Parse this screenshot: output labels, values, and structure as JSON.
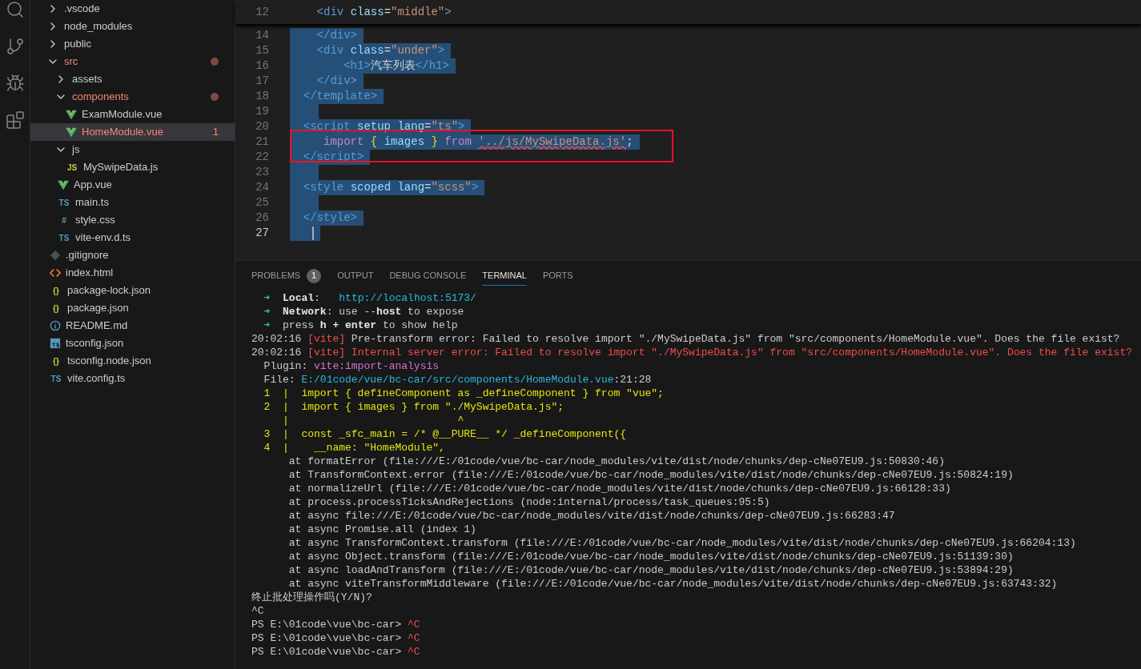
{
  "activity_bar": [
    {
      "kind": "search",
      "selected": false
    },
    {
      "kind": "source-control",
      "selected": false
    },
    {
      "kind": "run-debug",
      "selected": false
    },
    {
      "kind": "extensions",
      "selected": false
    }
  ],
  "explorer": {
    "items": [
      {
        "name": ".vscode",
        "kind": "folder",
        "expanded": false,
        "error": false,
        "modified": false,
        "selected": false
      },
      {
        "name": "node_modules",
        "kind": "folder",
        "expanded": false,
        "error": false,
        "modified": false,
        "selected": false
      },
      {
        "name": "public",
        "kind": "folder",
        "expanded": false,
        "error": false,
        "modified": false,
        "selected": false
      },
      {
        "name": "src",
        "kind": "folder",
        "expanded": true,
        "error": true,
        "modified": true,
        "selected": false,
        "children": [
          {
            "name": "assets",
            "kind": "folder",
            "expanded": false,
            "error": false,
            "modified": false,
            "selected": false
          },
          {
            "name": "components",
            "kind": "folder",
            "expanded": true,
            "error": true,
            "modified": true,
            "selected": false,
            "children": [
              {
                "name": "ExamModule.vue",
                "kind": "vue",
                "error": false,
                "modified": false,
                "selected": false
              },
              {
                "name": "HomeModule.vue",
                "kind": "vue",
                "error": true,
                "modified": false,
                "selected": true,
                "badge": "1"
              }
            ]
          },
          {
            "name": "js",
            "kind": "folder",
            "expanded": true,
            "error": false,
            "modified": false,
            "selected": false,
            "children": [
              {
                "name": "MySwipeData.js",
                "kind": "glyph",
                "glyph": "JS",
                "color": "#cbcb41",
                "error": false,
                "modified": false,
                "selected": false
              }
            ]
          },
          {
            "name": "App.vue",
            "kind": "vue",
            "error": false,
            "modified": false,
            "selected": false
          },
          {
            "name": "main.ts",
            "kind": "glyph",
            "glyph": "TS",
            "color": "#519aba",
            "error": false,
            "modified": false,
            "selected": false
          },
          {
            "name": "style.css",
            "kind": "glyph",
            "glyph": "#",
            "color": "#519aba",
            "error": false,
            "modified": false,
            "selected": false
          },
          {
            "name": "vite-env.d.ts",
            "kind": "glyph",
            "glyph": "TS",
            "color": "#519aba",
            "error": false,
            "modified": false,
            "selected": false
          }
        ]
      },
      {
        "name": ".gitignore",
        "kind": "git",
        "error": false,
        "modified": false,
        "selected": false
      },
      {
        "name": "index.html",
        "kind": "html",
        "error": false,
        "modified": false,
        "selected": false
      },
      {
        "name": "package-lock.json",
        "kind": "glyph",
        "glyph": "{}",
        "color": "#cbcb41",
        "error": false,
        "modified": false,
        "selected": false
      },
      {
        "name": "package.json",
        "kind": "glyph",
        "glyph": "{}",
        "color": "#cbcb41",
        "error": false,
        "modified": false,
        "selected": false
      },
      {
        "name": "README.md",
        "kind": "info",
        "error": false,
        "modified": false,
        "selected": false
      },
      {
        "name": "tsconfig.json",
        "kind": "tsconfig",
        "error": false,
        "modified": false,
        "selected": false
      },
      {
        "name": "tsconfig.node.json",
        "kind": "glyph",
        "glyph": "{}",
        "color": "#cbcb41",
        "error": false,
        "modified": false,
        "selected": false
      },
      {
        "name": "vite.config.ts",
        "kind": "glyph",
        "glyph": "TS",
        "color": "#519aba",
        "error": false,
        "modified": false,
        "selected": false
      }
    ]
  },
  "editor": {
    "sticky_line": {
      "number": "12",
      "tokens": [
        {
          "t": "    <div ",
          "kind": "tag"
        },
        {
          "t": "class",
          "kind": "attr"
        },
        {
          "t": "=",
          "kind": "text"
        },
        {
          "t": "\"middle\"",
          "kind": "str"
        },
        {
          "t": ">",
          "kind": "tag"
        }
      ]
    },
    "lines": [
      {
        "number": "14",
        "selected": true,
        "current": false,
        "tokens": [
          {
            "t": "    </div>",
            "kind": "tag"
          }
        ]
      },
      {
        "number": "15",
        "selected": true,
        "current": false,
        "tokens": [
          {
            "t": "    <div ",
            "kind": "tag"
          },
          {
            "t": "class",
            "kind": "attr"
          },
          {
            "t": "=",
            "kind": "text"
          },
          {
            "t": "\"under\"",
            "kind": "str"
          },
          {
            "t": ">",
            "kind": "tag"
          }
        ]
      },
      {
        "number": "16",
        "selected": true,
        "current": false,
        "tokens": [
          {
            "t": "        <h1>",
            "kind": "tag"
          },
          {
            "t": "汽车列表",
            "kind": "text"
          },
          {
            "t": "</h1>",
            "kind": "tag"
          }
        ]
      },
      {
        "number": "17",
        "selected": true,
        "current": false,
        "tokens": [
          {
            "t": "    </div>",
            "kind": "tag"
          }
        ]
      },
      {
        "number": "18",
        "selected": true,
        "current": false,
        "tokens": [
          {
            "t": "  </template>",
            "kind": "tag"
          }
        ]
      },
      {
        "number": "19",
        "selected": true,
        "current": false
      },
      {
        "number": "20",
        "selected": true,
        "current": false,
        "tokens": [
          {
            "t": "  <script ",
            "kind": "tag"
          },
          {
            "t": "setup lang",
            "kind": "attr"
          },
          {
            "t": "=",
            "kind": "text"
          },
          {
            "t": "\"ts\"",
            "kind": "str"
          },
          {
            "t": ">",
            "kind": "tag"
          }
        ]
      },
      {
        "number": "21",
        "selected": true,
        "current": false,
        "tokens": [
          {
            "t": "     import ",
            "kind": "kw"
          },
          {
            "t": "{ ",
            "kind": "brace"
          },
          {
            "t": "images ",
            "kind": "attr"
          },
          {
            "t": "} ",
            "kind": "brace"
          },
          {
            "t": "from ",
            "kind": "kw"
          },
          {
            "t": "'../js/MySwipeData.js'",
            "kind": "str",
            "error": true
          },
          {
            "t": ";",
            "kind": "text"
          }
        ]
      },
      {
        "number": "22",
        "selected": true,
        "current": false,
        "tokens": [
          {
            "t": "  </script>",
            "kind": "tag"
          }
        ]
      },
      {
        "number": "23",
        "selected": true,
        "current": false
      },
      {
        "number": "24",
        "selected": true,
        "current": false,
        "tokens": [
          {
            "t": "  <style ",
            "kind": "tag"
          },
          {
            "t": "scoped lang",
            "kind": "attr"
          },
          {
            "t": "=",
            "kind": "text"
          },
          {
            "t": "\"scss\"",
            "kind": "str"
          },
          {
            "t": ">",
            "kind": "tag"
          }
        ]
      },
      {
        "number": "25",
        "selected": true,
        "current": false
      },
      {
        "number": "26",
        "selected": true,
        "current": false,
        "tokens": [
          {
            "t": "  </style>",
            "kind": "tag"
          }
        ]
      },
      {
        "number": "27",
        "selected": true,
        "current": true
      }
    ]
  },
  "panel": {
    "tabs": [
      {
        "label": "PROBLEMS",
        "badge": "1",
        "selected": false
      },
      {
        "label": "OUTPUT",
        "selected": false
      },
      {
        "label": "DEBUG CONSOLE",
        "selected": false
      },
      {
        "label": "TERMINAL",
        "selected": true
      },
      {
        "label": "PORTS",
        "selected": false
      }
    ],
    "terminal_lines": [
      [
        {
          "t": "  ➜  ",
          "kind": "green"
        },
        {
          "t": "Local",
          "kind": "bold"
        },
        {
          "t": ":   ",
          "kind": "plain"
        },
        {
          "t": "http://localhost:5173/",
          "kind": "cyan"
        }
      ],
      [
        {
          "t": "  ➜  ",
          "kind": "green"
        },
        {
          "t": "Network",
          "kind": "bold"
        },
        {
          "t": ": use --",
          "kind": "plain"
        },
        {
          "t": "host",
          "kind": "bold"
        },
        {
          "t": " to expose",
          "kind": "plain"
        }
      ],
      [
        {
          "t": "  ➜  ",
          "kind": "green"
        },
        {
          "t": "press ",
          "kind": "plain"
        },
        {
          "t": "h + enter",
          "kind": "bold"
        },
        {
          "t": " to show help",
          "kind": "plain"
        }
      ],
      [
        {
          "t": "20:02:16 ",
          "kind": "plain"
        },
        {
          "t": "[vite]",
          "kind": "red"
        },
        {
          "t": " Pre-transform error: Failed to resolve import \"./MySwipeData.js\" from \"src/components/HomeModule.vue\". Does the file exist?",
          "kind": "plain"
        }
      ],
      [
        {
          "t": "20:02:16 ",
          "kind": "plain"
        },
        {
          "t": "[vite]",
          "kind": "red"
        },
        {
          "t": " Internal server error: Failed to resolve import \"./MySwipeData.js\" from \"src/components/HomeModule.vue\". Does the file exist?",
          "kind": "red"
        }
      ],
      [
        {
          "t": "  Plugin: ",
          "kind": "plain"
        },
        {
          "t": "vite:import-analysis",
          "kind": "magenta"
        }
      ],
      [
        {
          "t": "  File: ",
          "kind": "plain"
        },
        {
          "t": "E:/01code/vue/bc-car/src/components/HomeModule.vue",
          "kind": "cyan"
        },
        {
          "t": ":21:28",
          "kind": "plain"
        }
      ],
      [
        {
          "t": "  1  |  import { defineComponent as _defineComponent } from \"vue\";",
          "kind": "yellow"
        }
      ],
      [
        {
          "t": "  2  |  import { images } from \"./MySwipeData.js\";",
          "kind": "yellow"
        }
      ],
      [
        {
          "t": "     |                           ^",
          "kind": "yellow"
        }
      ],
      [
        {
          "t": "  3  |  const _sfc_main = /* @__PURE__ */ _defineComponent({",
          "kind": "yellow"
        }
      ],
      [
        {
          "t": "  4  |    __name: \"HomeModule\",",
          "kind": "yellow"
        }
      ],
      [
        {
          "t": "      at formatError (file:///E:/01code/vue/bc-car/node_modules/vite/dist/node/chunks/dep-cNe07EU9.js:50830:46)",
          "kind": "plain"
        }
      ],
      [
        {
          "t": "      at TransformContext.error (file:///E:/01code/vue/bc-car/node_modules/vite/dist/node/chunks/dep-cNe07EU9.js:50824:19)",
          "kind": "plain"
        }
      ],
      [
        {
          "t": "      at normalizeUrl (file:///E:/01code/vue/bc-car/node_modules/vite/dist/node/chunks/dep-cNe07EU9.js:66128:33)",
          "kind": "plain"
        }
      ],
      [
        {
          "t": "      at process.processTicksAndRejections (node:internal/process/task_queues:95:5)",
          "kind": "plain"
        }
      ],
      [
        {
          "t": "      at async file:///E:/01code/vue/bc-car/node_modules/vite/dist/node/chunks/dep-cNe07EU9.js:66283:47",
          "kind": "plain"
        }
      ],
      [
        {
          "t": "      at async Promise.all (index 1)",
          "kind": "plain"
        }
      ],
      [
        {
          "t": "      at async TransformContext.transform (file:///E:/01code/vue/bc-car/node_modules/vite/dist/node/chunks/dep-cNe07EU9.js:66204:13)",
          "kind": "plain"
        }
      ],
      [
        {
          "t": "      at async Object.transform (file:///E:/01code/vue/bc-car/node_modules/vite/dist/node/chunks/dep-cNe07EU9.js:51139:30)",
          "kind": "plain"
        }
      ],
      [
        {
          "t": "      at async loadAndTransform (file:///E:/01code/vue/bc-car/node_modules/vite/dist/node/chunks/dep-cNe07EU9.js:53894:29)",
          "kind": "plain"
        }
      ],
      [
        {
          "t": "      at async viteTransformMiddleware (file:///E:/01code/vue/bc-car/node_modules/vite/dist/node/chunks/dep-cNe07EU9.js:63743:32)",
          "kind": "plain"
        }
      ],
      [
        {
          "t": "终止批处理操作吗(Y/N)?",
          "kind": "plain"
        }
      ],
      [
        {
          "t": "^C",
          "kind": "plain"
        }
      ],
      [
        {
          "t": "PS E:\\01code\\vue\\bc-car> ",
          "kind": "plain"
        },
        {
          "t": "^C",
          "kind": "red"
        }
      ],
      [
        {
          "t": "PS E:\\01code\\vue\\bc-car> ",
          "kind": "plain"
        },
        {
          "t": "^C",
          "kind": "red"
        }
      ],
      [
        {
          "t": "PS E:\\01code\\vue\\bc-car> ",
          "kind": "plain"
        },
        {
          "t": "^C",
          "kind": "red"
        }
      ]
    ]
  }
}
